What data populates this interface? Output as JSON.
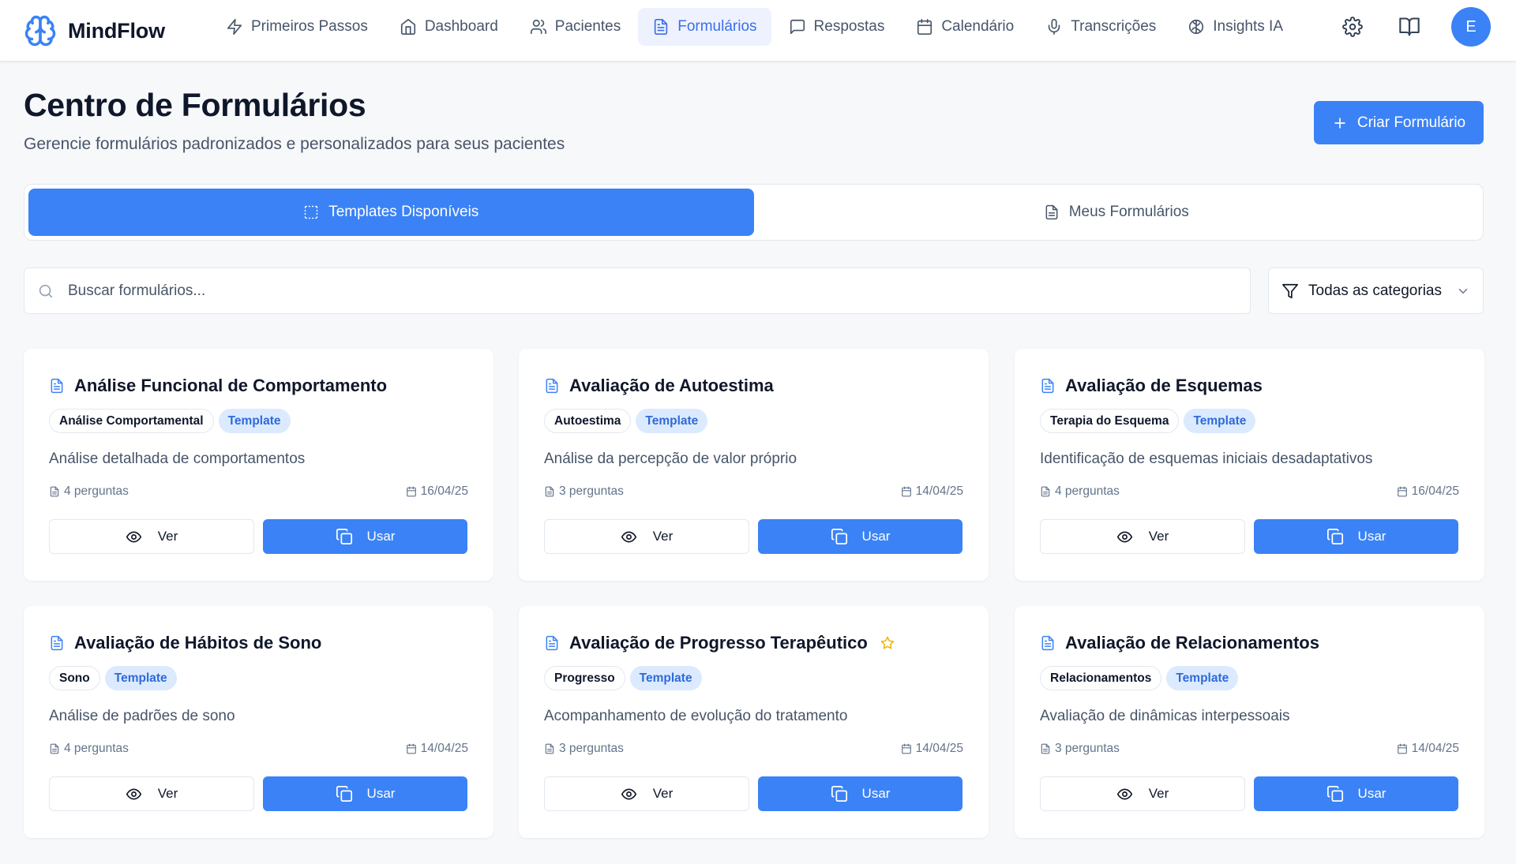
{
  "app": {
    "name": "MindFlow",
    "avatar_initial": "E",
    "brand_color": "#3b82f6"
  },
  "nav": {
    "items": [
      {
        "label": "Primeiros Passos",
        "icon": "zap-icon"
      },
      {
        "label": "Dashboard",
        "icon": "home-icon"
      },
      {
        "label": "Pacientes",
        "icon": "users-icon"
      },
      {
        "label": "Formulários",
        "icon": "file-text-icon",
        "active": true
      },
      {
        "label": "Respostas",
        "icon": "message-square-icon"
      },
      {
        "label": "Calendário",
        "icon": "calendar-icon"
      },
      {
        "label": "Transcrições",
        "icon": "mic-icon"
      },
      {
        "label": "Insights IA",
        "icon": "brain-icon"
      }
    ]
  },
  "header": {
    "title": "Centro de Formulários",
    "subtitle": "Gerencie formulários padronizados e personalizados para seus pacientes",
    "create_label": "Criar Formulário"
  },
  "tabs": [
    {
      "label": "Templates Disponíveis",
      "active": true
    },
    {
      "label": "Meus Formulários",
      "active": false
    }
  ],
  "search": {
    "placeholder": "Buscar formulários...",
    "value": ""
  },
  "filter": {
    "selected": "Todas as categorias"
  },
  "cards": [
    {
      "title": "Análise Funcional de Comportamento",
      "category": "Análise Comportamental",
      "badge": "Template",
      "description": "Análise detalhada de comportamentos",
      "questions": "4 perguntas",
      "date": "16/04/25",
      "starred": false,
      "view_label": "Ver",
      "use_label": "Usar"
    },
    {
      "title": "Avaliação de Autoestima",
      "category": "Autoestima",
      "badge": "Template",
      "description": "Análise da percepção de valor próprio",
      "questions": "3 perguntas",
      "date": "14/04/25",
      "starred": false,
      "view_label": "Ver",
      "use_label": "Usar"
    },
    {
      "title": "Avaliação de Esquemas",
      "category": "Terapia do Esquema",
      "badge": "Template",
      "description": "Identificação de esquemas iniciais desadaptativos",
      "questions": "4 perguntas",
      "date": "16/04/25",
      "starred": false,
      "view_label": "Ver",
      "use_label": "Usar"
    },
    {
      "title": "Avaliação de Hábitos de Sono",
      "category": "Sono",
      "badge": "Template",
      "description": "Análise de padrões de sono",
      "questions": "4 perguntas",
      "date": "14/04/25",
      "starred": false,
      "view_label": "Ver",
      "use_label": "Usar"
    },
    {
      "title": "Avaliação de Progresso Terapêutico",
      "category": "Progresso",
      "badge": "Template",
      "description": "Acompanhamento de evolução do tratamento",
      "questions": "3 perguntas",
      "date": "14/04/25",
      "starred": true,
      "view_label": "Ver",
      "use_label": "Usar"
    },
    {
      "title": "Avaliação de Relacionamentos",
      "category": "Relacionamentos",
      "badge": "Template",
      "description": "Avaliação de dinâmicas interpessoais",
      "questions": "3 perguntas",
      "date": "14/04/25",
      "starred": false,
      "view_label": "Ver",
      "use_label": "Usar"
    }
  ]
}
